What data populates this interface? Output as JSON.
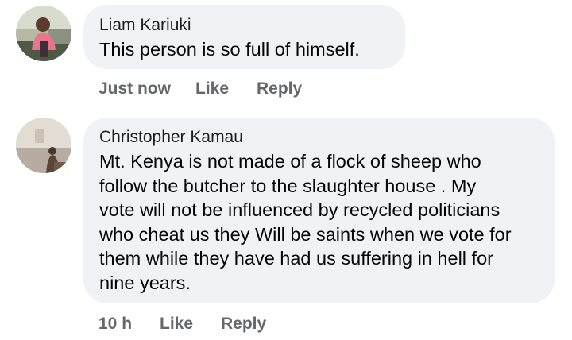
{
  "comments": [
    {
      "author": "Liam Kariuki",
      "text": "This person is so full of himself.",
      "time": "Just now",
      "like_label": "Like",
      "reply_label": "Reply"
    },
    {
      "author": "Christopher Kamau",
      "text_lines": [
        "Mt. Kenya is not made of a flock of sheep who",
        "follow the butcher to the slaughter house . My",
        "vote will not be influenced by recycled politicians",
        "who cheat us they Will be saints when we vote for",
        "them while they have had us suffering in hell for",
        "nine years."
      ],
      "time": "10 h",
      "like_label": "Like",
      "reply_label": "Reply"
    }
  ],
  "colors": {
    "bubble": "#f0f2f5",
    "meta_text": "#65676b",
    "body_text": "#050505"
  }
}
